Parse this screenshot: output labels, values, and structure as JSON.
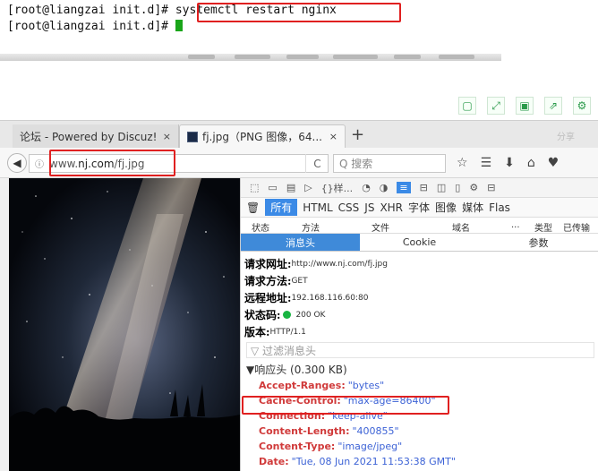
{
  "terminal": {
    "line1_prompt": "[root@liangzai init.d]# ",
    "line1_command": "systemctl restart nginx",
    "line2_prompt": "[root@liangzai init.d]# "
  },
  "browser": {
    "tab1": {
      "label": "论坛 - Powered by Discuz!",
      "close": "×"
    },
    "tab2": {
      "label": "fj.jpg（PNG 图像，64...",
      "close": "×"
    },
    "new_tab": "+",
    "faded_right": "分享",
    "url_prefix": "www.",
    "url_domain": "nj.com",
    "url_path": "/fj.jpg",
    "reload": "C",
    "search_placeholder": "Q 搜索"
  },
  "devtools": {
    "toolbar_label": "{}样...",
    "filters": [
      "所有",
      "HTML",
      "CSS",
      "JS",
      "XHR",
      "字体",
      "图像",
      "媒体",
      "Flas"
    ],
    "active_filter": "所有",
    "columns": [
      "状态",
      "方法",
      "文件",
      "域名",
      "...",
      "类型",
      "已传输"
    ],
    "subtabs": [
      "消息头",
      "Cookie",
      "参数"
    ],
    "active_subtab": "消息头",
    "summary": [
      {
        "key": "请求网址:",
        "value": "http://www.nj.com/fj.jpg"
      },
      {
        "key": "请求方法:",
        "value": "GET"
      },
      {
        "key": "远程地址:",
        "value": "192.168.116.60:80"
      },
      {
        "key": "状态码:",
        "value": "200 OK"
      },
      {
        "key": "版本:",
        "value": "HTTP/1.1"
      }
    ],
    "filter_placeholder": "▽ 过滤消息头",
    "response_section": "▼响应头 (0.300 KB)",
    "response_headers": [
      {
        "name": "Accept-Ranges:",
        "value": "\"bytes\""
      },
      {
        "name": "Cache-Control:",
        "value": "\"max-age=86400\""
      },
      {
        "name": "Connection:",
        "value": "\"keep-alive\""
      },
      {
        "name": "Content-Length:",
        "value": "\"400855\""
      },
      {
        "name": "Content-Type:",
        "value": "\"image/jpeg\""
      },
      {
        "name": "Date:",
        "value": "\"Tue, 08 Jun 2021 11:53:38 GMT\""
      }
    ]
  },
  "colors": {
    "highlight": "#e02020",
    "status_ok": "#19b542",
    "header_name": "#d03a3a",
    "header_value": "#3d63d6"
  }
}
